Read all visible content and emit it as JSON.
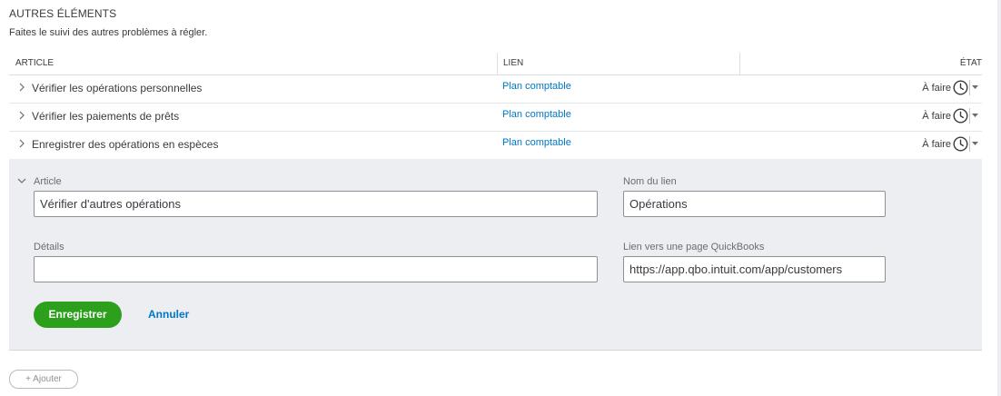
{
  "section": {
    "title": "AUTRES ÉLÉMENTS",
    "subtitle": "Faites le suivi des autres problèmes à régler."
  },
  "columns": {
    "article": "ARTICLE",
    "lien": "LIEN",
    "etat": "ÉTAT"
  },
  "rows": [
    {
      "label": "Vérifier les opérations personnelles",
      "link": "Plan comptable",
      "status": "À faire"
    },
    {
      "label": "Vérifier les paiements de prêts",
      "link": "Plan comptable",
      "status": "À faire"
    },
    {
      "label": "Enregistrer des opérations en espèces",
      "link": "Plan comptable",
      "status": "À faire"
    }
  ],
  "icons": {
    "row_expand": "chevron-right-icon",
    "status": "clock-icon",
    "status_menu": "caret-down-icon",
    "panel_collapse": "chevron-down-icon"
  },
  "form": {
    "article_label": "Article",
    "article_value": "Vérifier d'autres opérations",
    "link_name_label": "Nom du lien",
    "link_name_value": "Opérations",
    "details_label": "Détails",
    "details_value": "",
    "qb_link_label": "Lien vers une page QuickBooks",
    "qb_link_value": "https://app.qbo.intuit.com/app/customers",
    "save_label": "Enregistrer",
    "cancel_label": "Annuler"
  },
  "add_label": "+ Ajouter",
  "colors": {
    "accent_green": "#2ca01c",
    "link_blue": "#0077c5",
    "panel_bg": "#eceef1",
    "text": "#393a3d"
  }
}
